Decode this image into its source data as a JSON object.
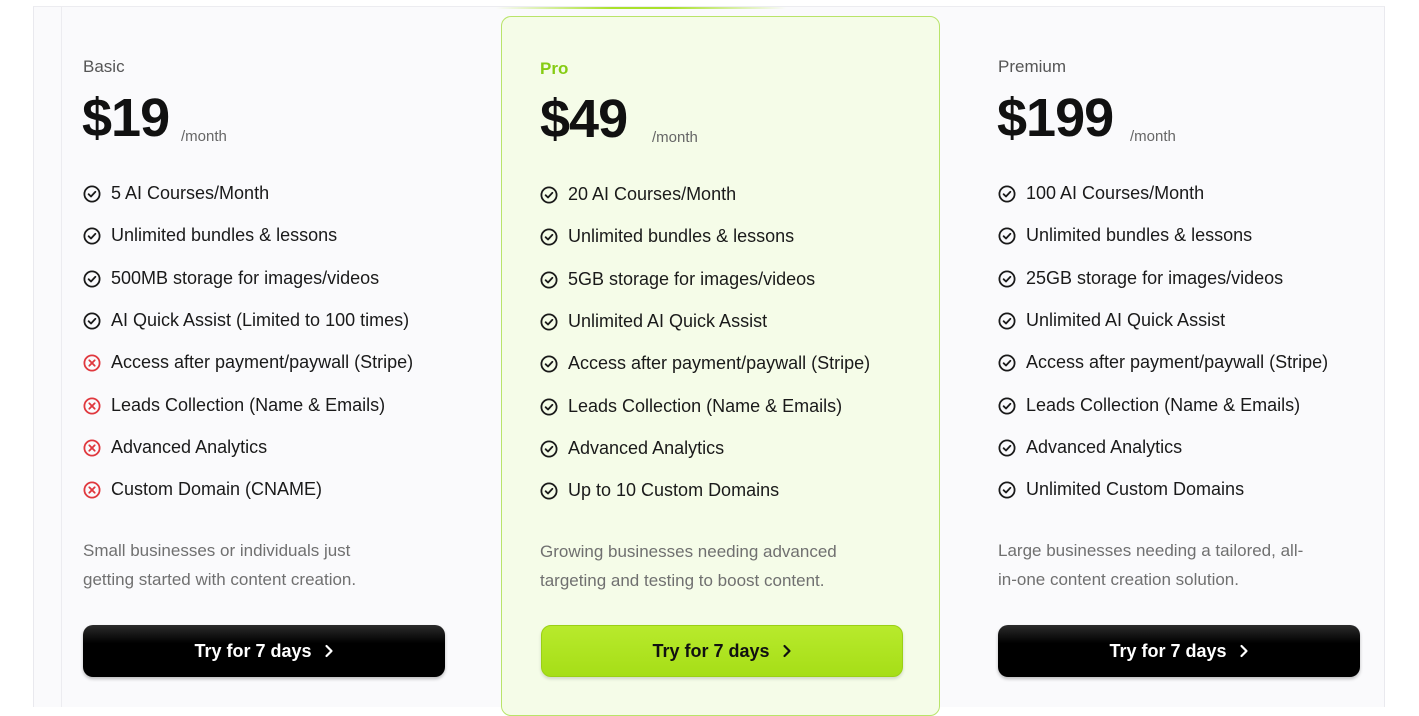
{
  "plans": [
    {
      "name": "Basic",
      "price": "$19",
      "period": "/month",
      "features": [
        {
          "text": "5 AI Courses/Month",
          "included": true
        },
        {
          "text": "Unlimited bundles & lessons",
          "included": true
        },
        {
          "text": "500MB storage for images/videos",
          "included": true
        },
        {
          "text": "AI Quick Assist (Limited to 100 times)",
          "included": true
        },
        {
          "text": "Access after payment/paywall (Stripe)",
          "included": false
        },
        {
          "text": "Leads Collection (Name & Emails)",
          "included": false
        },
        {
          "text": "Advanced Analytics",
          "included": false
        },
        {
          "text": "Custom Domain (CNAME)",
          "included": false
        }
      ],
      "description_line1": "Small businesses or individuals just",
      "description_line2": "getting started with content creation.",
      "cta_label": "Try for 7 days"
    },
    {
      "name": "Pro",
      "price": "$49",
      "period": "/month",
      "features": [
        {
          "text": "20 AI Courses/Month",
          "included": true
        },
        {
          "text": "Unlimited bundles & lessons",
          "included": true
        },
        {
          "text": "5GB storage for images/videos",
          "included": true
        },
        {
          "text": "Unlimited AI Quick Assist",
          "included": true
        },
        {
          "text": "Access after payment/paywall (Stripe)",
          "included": true
        },
        {
          "text": "Leads Collection (Name & Emails)",
          "included": true
        },
        {
          "text": "Advanced Analytics",
          "included": true
        },
        {
          "text": "Up to 10 Custom Domains",
          "included": true
        }
      ],
      "description_line1": "Growing businesses needing advanced",
      "description_line2": "targeting and testing to boost content.",
      "cta_label": "Try for 7 days"
    },
    {
      "name": "Premium",
      "price": "$199",
      "period": "/month",
      "features": [
        {
          "text": "100 AI Courses/Month",
          "included": true
        },
        {
          "text": "Unlimited bundles & lessons",
          "included": true
        },
        {
          "text": "25GB storage for images/videos",
          "included": true
        },
        {
          "text": "Unlimited AI Quick Assist",
          "included": true
        },
        {
          "text": "Access after payment/paywall (Stripe)",
          "included": true
        },
        {
          "text": "Leads Collection (Name & Emails)",
          "included": true
        },
        {
          "text": "Advanced Analytics",
          "included": true
        },
        {
          "text": "Unlimited Custom Domains",
          "included": true
        }
      ],
      "description_line1": "Large businesses needing a tailored, all-",
      "description_line2": "in-one content creation solution.",
      "cta_label": "Try for 7 days"
    }
  ],
  "icons": {
    "included": "check-circle-icon",
    "excluded": "x-circle-icon",
    "cta": "chevron-right-icon"
  },
  "colors": {
    "accent": "#a6de17",
    "accent_text": "#86cc14",
    "excluded": "#e0383e",
    "pro_bg": "#f5fce8"
  }
}
